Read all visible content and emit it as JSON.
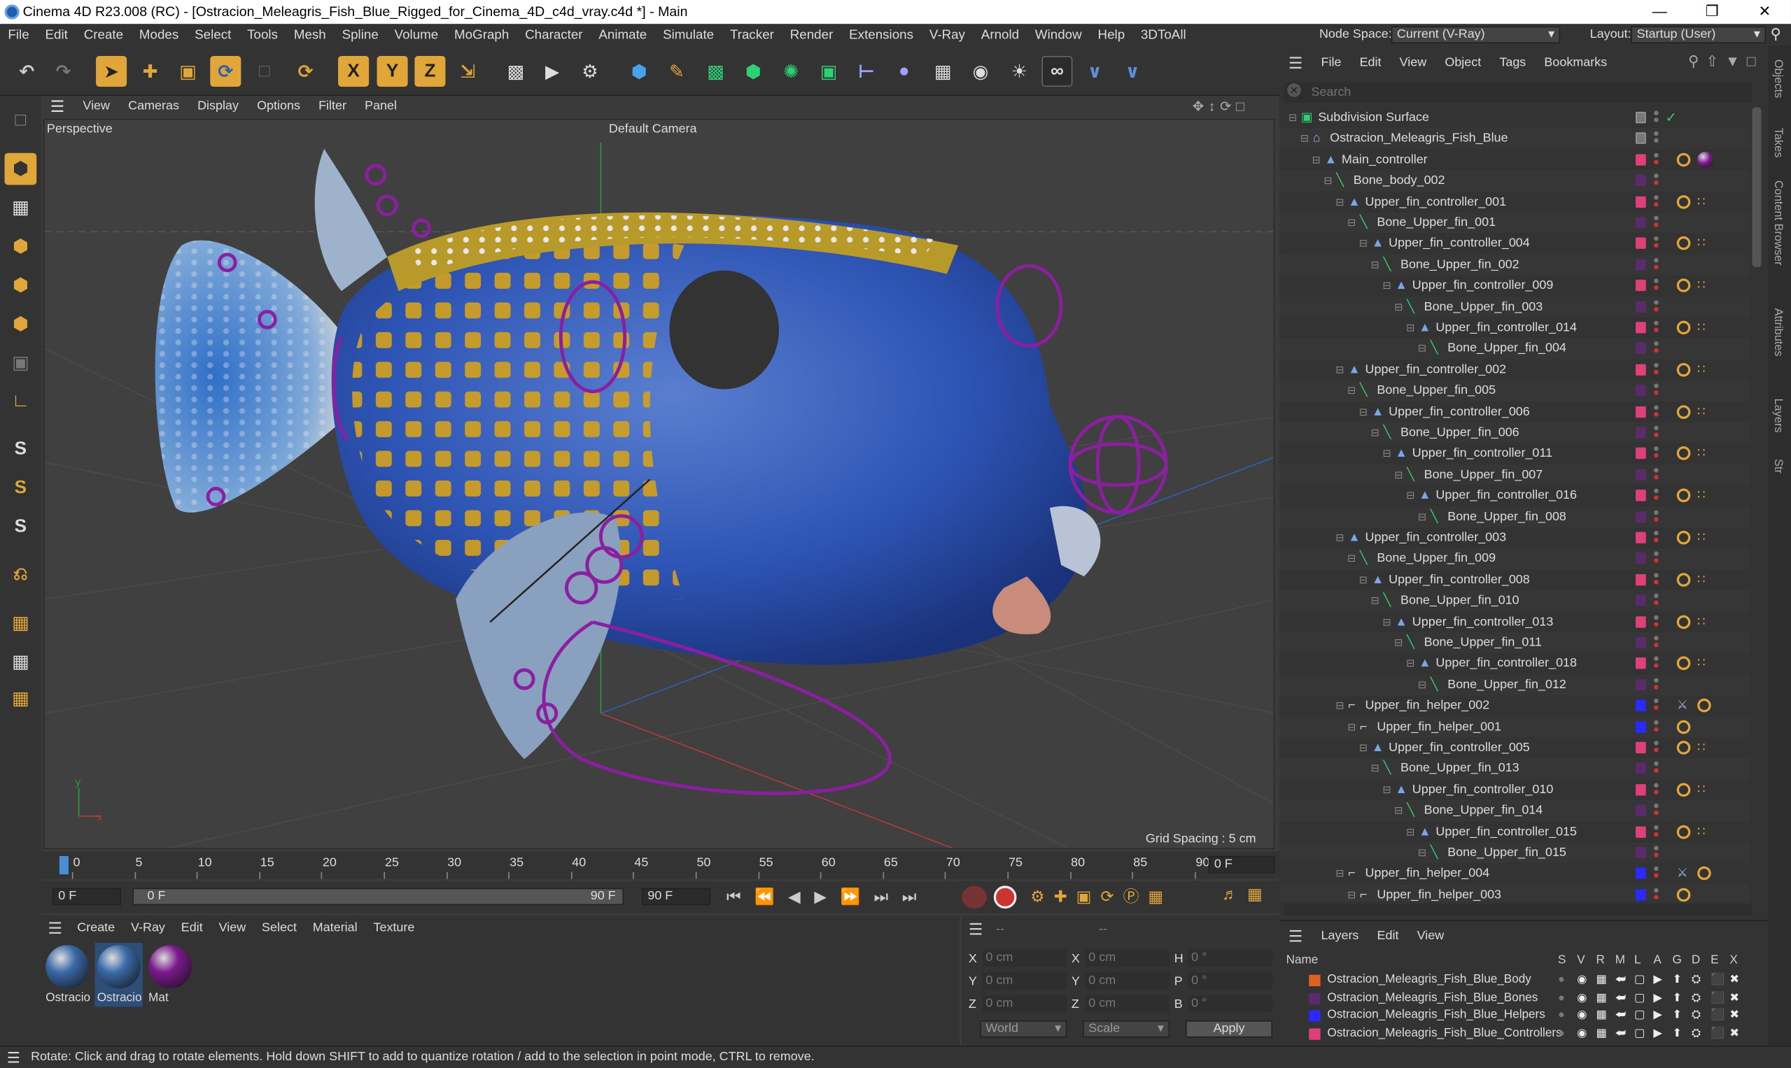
{
  "window": {
    "title": "Cinema 4D R23.008 (RC) - [Ostracion_Meleagris_Fish_Blue_Rigged_for_Cinema_4D_c4d_vray.c4d *] - Main"
  },
  "menu": [
    "File",
    "Edit",
    "Create",
    "Modes",
    "Select",
    "Tools",
    "Mesh",
    "Spline",
    "Volume",
    "MoGraph",
    "Character",
    "Animate",
    "Simulate",
    "Tracker",
    "Render",
    "Extensions",
    "V-Ray",
    "Arnold",
    "Window",
    "Help",
    "3DToAll"
  ],
  "nodespace": {
    "label": "Node Space:",
    "value": "Current (V-Ray)",
    "layout_label": "Layout:",
    "layout_value": "Startup (User)"
  },
  "viewport": {
    "menu": [
      "View",
      "Cameras",
      "Display",
      "Options",
      "Filter",
      "Panel"
    ],
    "projection": "Perspective",
    "camera": "Default Camera",
    "grid_spacing": "Grid Spacing : 5 cm"
  },
  "timeline": {
    "ticks": [
      "0",
      "5",
      "10",
      "15",
      "20",
      "25",
      "30",
      "35",
      "40",
      "45",
      "50",
      "55",
      "60",
      "65",
      "70",
      "75",
      "80",
      "85",
      "90"
    ],
    "current_frame": "0 F"
  },
  "transport": {
    "start": "0 F",
    "range_start": "0 F",
    "range_end": "90 F",
    "end": "90 F"
  },
  "materials": {
    "menu": [
      "Create",
      "V-Ray",
      "Edit",
      "View",
      "Select",
      "Material",
      "Texture"
    ],
    "items": [
      {
        "label": "Ostracio",
        "color": "#3a6aa8"
      },
      {
        "label": "Ostracio",
        "color": "#3a6aa8"
      },
      {
        "label": "Mat",
        "color": "#7a1a8c"
      }
    ]
  },
  "coords": {
    "rows": [
      {
        "a": "X",
        "av": "0 cm",
        "b": "X",
        "bv": "0 cm",
        "c": "H",
        "cv": "0 °"
      },
      {
        "a": "Y",
        "av": "0 cm",
        "b": "Y",
        "bv": "0 cm",
        "c": "P",
        "cv": "0 °"
      },
      {
        "a": "Z",
        "av": "0 cm",
        "b": "Z",
        "bv": "0 cm",
        "c": "B",
        "cv": "0 °"
      }
    ],
    "world": "World",
    "scale": "Scale",
    "apply": "Apply",
    "dash1": "--",
    "dash2": "--"
  },
  "objects": {
    "menu": [
      "File",
      "Edit",
      "View",
      "Object",
      "Tags",
      "Bookmarks"
    ],
    "search_placeholder": "Search",
    "rows": [
      {
        "label": "Subdivision Surface",
        "depth": 0,
        "icon": "subdiv",
        "color": "",
        "tags": "check"
      },
      {
        "label": "Ostracion_Meleagris_Fish_Blue",
        "depth": 1,
        "icon": "null",
        "color": "",
        "tags": "none"
      },
      {
        "label": "Main_controller",
        "depth": 2,
        "icon": "ctrl",
        "color": "#e0407a",
        "tags": "ctrl-mat"
      },
      {
        "label": "Bone_body_002",
        "depth": 3,
        "icon": "bone",
        "color": "#5a2a6a",
        "tags": "none"
      },
      {
        "label": "Upper_fin_controller_001",
        "depth": 4,
        "icon": "ctrl",
        "color": "#e0407a",
        "tags": "ctrl"
      },
      {
        "label": "Bone_Upper_fin_001",
        "depth": 5,
        "icon": "bone",
        "color": "#5a2a6a",
        "tags": "none"
      },
      {
        "label": "Upper_fin_controller_004",
        "depth": 6,
        "icon": "ctrl",
        "color": "#e0407a",
        "tags": "ctrl"
      },
      {
        "label": "Bone_Upper_fin_002",
        "depth": 7,
        "icon": "bone",
        "color": "#5a2a6a",
        "tags": "none"
      },
      {
        "label": "Upper_fin_controller_009",
        "depth": 8,
        "icon": "ctrl",
        "color": "#e0407a",
        "tags": "ctrl"
      },
      {
        "label": "Bone_Upper_fin_003",
        "depth": 9,
        "icon": "bone",
        "color": "#5a2a6a",
        "tags": "none"
      },
      {
        "label": "Upper_fin_controller_014",
        "depth": 10,
        "icon": "ctrl",
        "color": "#e0407a",
        "tags": "ctrl"
      },
      {
        "label": "Bone_Upper_fin_004",
        "depth": 11,
        "icon": "bone",
        "color": "#5a2a6a",
        "tags": "none"
      },
      {
        "label": "Upper_fin_controller_002",
        "depth": 4,
        "icon": "ctrl",
        "color": "#e0407a",
        "tags": "ctrl"
      },
      {
        "label": "Bone_Upper_fin_005",
        "depth": 5,
        "icon": "bone",
        "color": "#5a2a6a",
        "tags": "none"
      },
      {
        "label": "Upper_fin_controller_006",
        "depth": 6,
        "icon": "ctrl",
        "color": "#e0407a",
        "tags": "ctrl"
      },
      {
        "label": "Bone_Upper_fin_006",
        "depth": 7,
        "icon": "bone",
        "color": "#5a2a6a",
        "tags": "none"
      },
      {
        "label": "Upper_fin_controller_011",
        "depth": 8,
        "icon": "ctrl",
        "color": "#e0407a",
        "tags": "ctrl"
      },
      {
        "label": "Bone_Upper_fin_007",
        "depth": 9,
        "icon": "bone",
        "color": "#5a2a6a",
        "tags": "none"
      },
      {
        "label": "Upper_fin_controller_016",
        "depth": 10,
        "icon": "ctrl",
        "color": "#e0407a",
        "tags": "ctrl"
      },
      {
        "label": "Bone_Upper_fin_008",
        "depth": 11,
        "icon": "bone",
        "color": "#5a2a6a",
        "tags": "none"
      },
      {
        "label": "Upper_fin_controller_003",
        "depth": 4,
        "icon": "ctrl",
        "color": "#e0407a",
        "tags": "ctrl"
      },
      {
        "label": "Bone_Upper_fin_009",
        "depth": 5,
        "icon": "bone",
        "color": "#5a2a6a",
        "tags": "none"
      },
      {
        "label": "Upper_fin_controller_008",
        "depth": 6,
        "icon": "ctrl",
        "color": "#e0407a",
        "tags": "ctrl"
      },
      {
        "label": "Bone_Upper_fin_010",
        "depth": 7,
        "icon": "bone",
        "color": "#5a2a6a",
        "tags": "none"
      },
      {
        "label": "Upper_fin_controller_013",
        "depth": 8,
        "icon": "ctrl",
        "color": "#e0407a",
        "tags": "ctrl"
      },
      {
        "label": "Bone_Upper_fin_011",
        "depth": 9,
        "icon": "bone",
        "color": "#5a2a6a",
        "tags": "none"
      },
      {
        "label": "Upper_fin_controller_018",
        "depth": 10,
        "icon": "ctrl",
        "color": "#e0407a",
        "tags": "ctrl"
      },
      {
        "label": "Bone_Upper_fin_012",
        "depth": 11,
        "icon": "bone",
        "color": "#5a2a6a",
        "tags": "none"
      },
      {
        "label": "Upper_fin_helper_002",
        "depth": 4,
        "icon": "helper",
        "color": "#2a2aff",
        "tags": "helper"
      },
      {
        "label": "Upper_fin_helper_001",
        "depth": 5,
        "icon": "helper",
        "color": "#2a2aff",
        "tags": "helper1"
      },
      {
        "label": "Upper_fin_controller_005",
        "depth": 6,
        "icon": "ctrl",
        "color": "#e0407a",
        "tags": "ctrl"
      },
      {
        "label": "Bone_Upper_fin_013",
        "depth": 7,
        "icon": "bone",
        "color": "#5a2a6a",
        "tags": "none"
      },
      {
        "label": "Upper_fin_controller_010",
        "depth": 8,
        "icon": "ctrl",
        "color": "#e0407a",
        "tags": "ctrl"
      },
      {
        "label": "Bone_Upper_fin_014",
        "depth": 9,
        "icon": "bone",
        "color": "#5a2a6a",
        "tags": "none"
      },
      {
        "label": "Upper_fin_controller_015",
        "depth": 10,
        "icon": "ctrl",
        "color": "#e0407a",
        "tags": "ctrl"
      },
      {
        "label": "Bone_Upper_fin_015",
        "depth": 11,
        "icon": "bone",
        "color": "#5a2a6a",
        "tags": "none"
      },
      {
        "label": "Upper_fin_helper_004",
        "depth": 4,
        "icon": "helper",
        "color": "#2a2aff",
        "tags": "helper"
      },
      {
        "label": "Upper_fin_helper_003",
        "depth": 5,
        "icon": "helper",
        "color": "#2a2aff",
        "tags": "helper1"
      }
    ]
  },
  "layers": {
    "menu": [
      "Layers",
      "Edit",
      "View"
    ],
    "header": {
      "name": "Name",
      "cols": [
        "S",
        "V",
        "R",
        "M",
        "L",
        "A",
        "G",
        "D",
        "E",
        "X"
      ]
    },
    "rows": [
      {
        "label": "Ostracion_Meleagris_Fish_Blue_Body",
        "color": "#e06020"
      },
      {
        "label": "Ostracion_Meleagris_Fish_Blue_Bones",
        "color": "#5a2a6a"
      },
      {
        "label": "Ostracion_Meleagris_Fish_Blue_Helpers",
        "color": "#2a2aff"
      },
      {
        "label": "Ostracion_Meleagris_Fish_Blue_Controllers",
        "color": "#e0407a"
      }
    ]
  },
  "right_tabs": [
    "Objects",
    "Takes",
    "Content Browser",
    "Attributes",
    "Layers",
    "Str"
  ],
  "status": "Rotate: Click and drag to rotate elements. Hold down SHIFT to add to quantize rotation / add to the selection in point mode, CTRL to remove."
}
